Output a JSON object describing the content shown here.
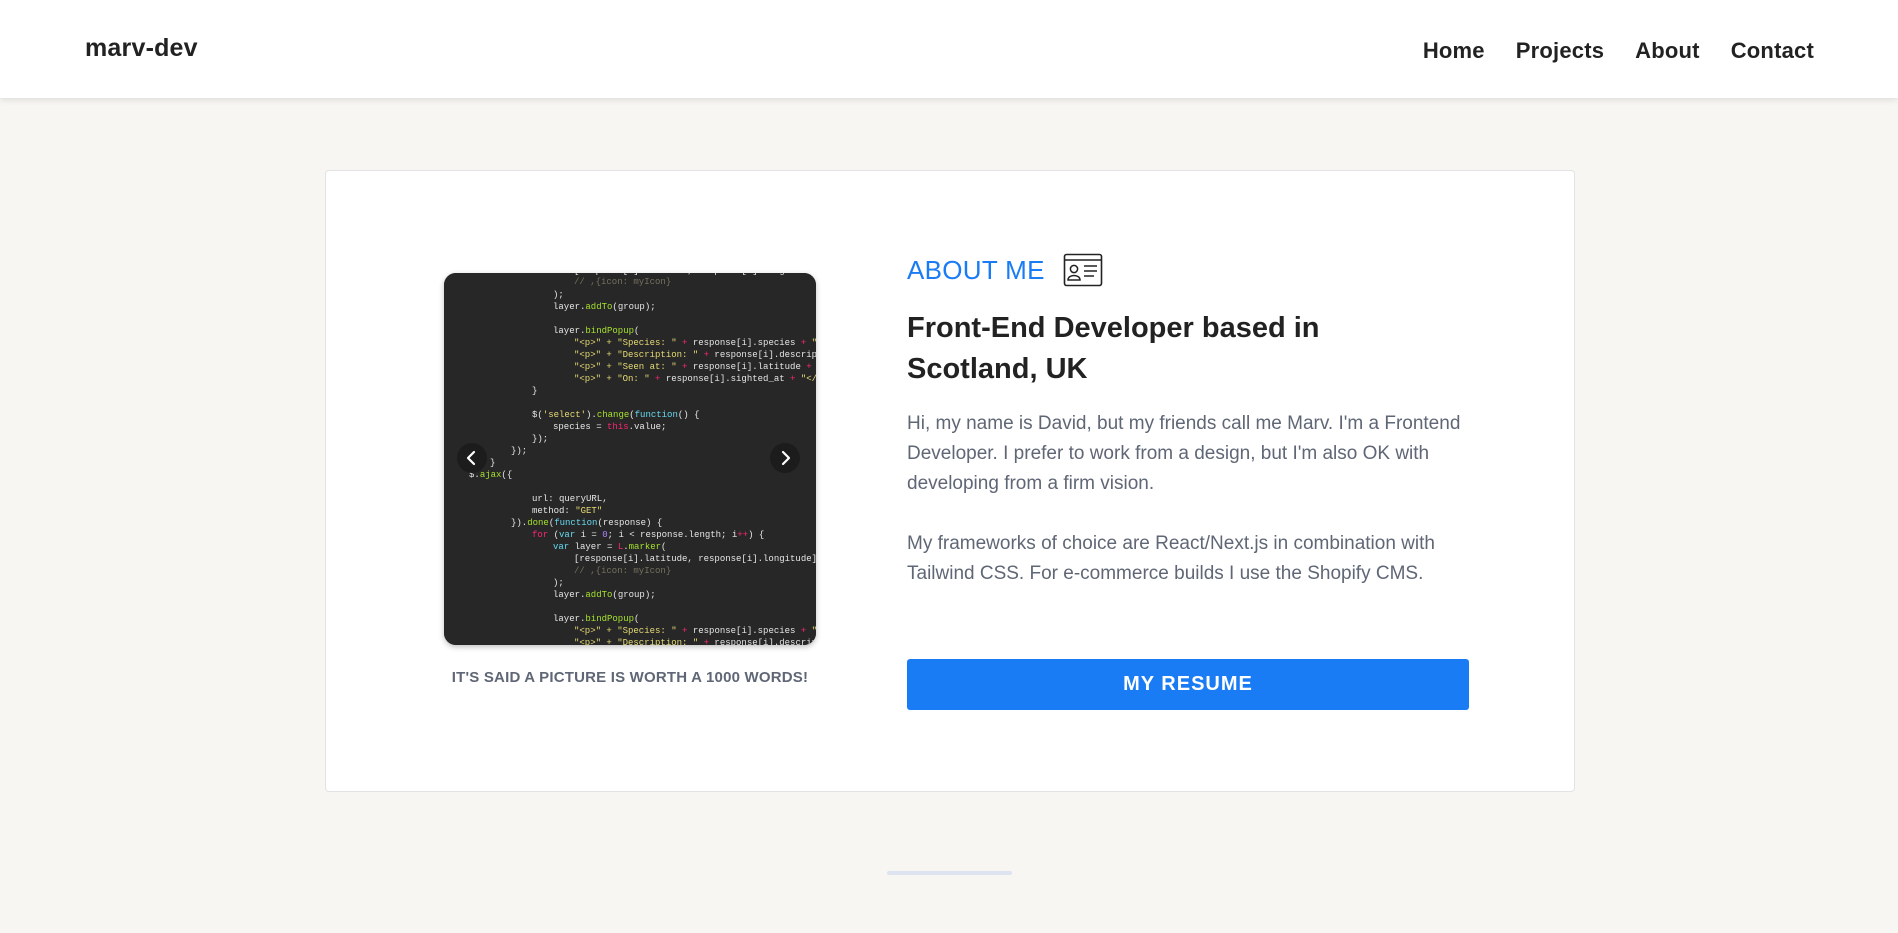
{
  "header": {
    "brand": "marv-dev",
    "nav": [
      "Home",
      "Projects",
      "About",
      "Contact"
    ]
  },
  "about": {
    "section_label": "ABOUT ME",
    "section_icon": "id-card-icon",
    "headline": "Front-End Developer based in Scotland, UK",
    "paragraphs": [
      "Hi, my name is David, but my friends call me Marv. I'm a Frontend Developer. I prefer to work from a design, but I'm also OK with developing from a firm vision.",
      "My frameworks of choice are React/Next.js in combination with Tailwind CSS. For e-commerce builds I use the Shopify CMS."
    ],
    "resume_button": "MY RESUME"
  },
  "carousel": {
    "caption": "IT'S SAID A PICTURE IS WORTH A 1000 WORDS!",
    "prev_icon": "chevron-left-icon",
    "next_icon": "chevron-right-icon"
  },
  "colors": {
    "accent": "#1a7cf5",
    "heading": "#222222",
    "body_text": "#5f6675",
    "page_bg": "#f7f6f3",
    "code_bg": "#272727"
  }
}
